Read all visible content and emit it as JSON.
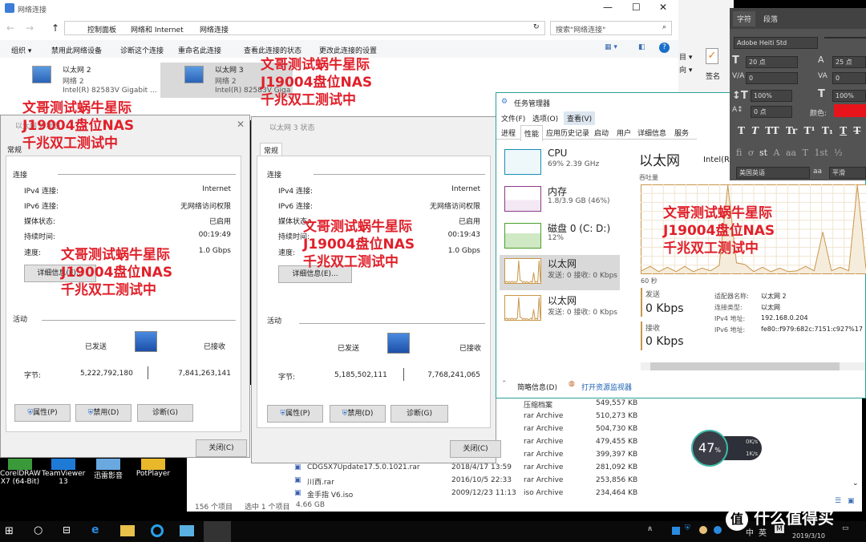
{
  "explorer": {
    "title": "网络连接",
    "breadcrumb": [
      "控制面板",
      "网络和 Internet",
      "网络连接"
    ],
    "search_placeholder": "搜索\"网络连接\"",
    "toolbar": [
      "组织 ▾",
      "禁用此网络设备",
      "诊断这个连接",
      "重命名此连接",
      "查看此连接的状态",
      "更改此连接的设置"
    ],
    "adapters": [
      {
        "name": "以太网 2",
        "network": "网络 2",
        "device": "Intel(R) 82583V Gigabit ..."
      },
      {
        "name": "以太网 3",
        "network": "网络 2",
        "device": "Intel(R) 82583V Gigabit ..."
      }
    ]
  },
  "side_window": {
    "ribbon_label": "签名",
    "ribbon_items": [
      "目 ▾",
      "向 ▾"
    ]
  },
  "dialog1": {
    "title": "以太网 2 状态",
    "tab": "常规",
    "section_connection": "连接",
    "rows": [
      [
        "IPv4 连接:",
        "Internet"
      ],
      [
        "IPv6 连接:",
        "无网络访问权限"
      ],
      [
        "媒体状态:",
        "已启用"
      ],
      [
        "持续时间:",
        "00:19:49"
      ],
      [
        "速度:",
        "1.0 Gbps"
      ]
    ],
    "details_button": "详细信息(E)...",
    "section_activity": "活动",
    "sent_label": "已发送",
    "received_label": "已接收",
    "bytes_label": "字节:",
    "bytes_sent": "5,222,792,180",
    "bytes_received": "7,841,263,141",
    "buttons": [
      "属性(P)",
      "禁用(D)",
      "诊断(G)"
    ],
    "close": "关闭(C)"
  },
  "dialog2": {
    "title": "以太网 3 状态",
    "tab": "常规",
    "section_connection": "连接",
    "rows": [
      [
        "IPv4 连接:",
        "Internet"
      ],
      [
        "IPv6 连接:",
        "无网络访问权限"
      ],
      [
        "媒体状态:",
        "已启用"
      ],
      [
        "持续时间:",
        "00:19:43"
      ],
      [
        "速度:",
        "1.0 Gbps"
      ]
    ],
    "details_button": "详细信息(E)...",
    "section_activity": "活动",
    "sent_label": "已发送",
    "received_label": "已接收",
    "bytes_label": "字节:",
    "bytes_sent": "5,185,502,111",
    "bytes_received": "7,768,241,065",
    "buttons": [
      "属性(P)",
      "禁用(D)",
      "诊断(G)"
    ],
    "close": "关闭(C)"
  },
  "task_manager": {
    "title": "任务管理器",
    "menu": [
      "文件(F)",
      "选项(O)",
      "查看(V)"
    ],
    "tabs": [
      "进程",
      "性能",
      "应用历史记录",
      "启动",
      "用户",
      "详细信息",
      "服务"
    ],
    "active_tab": "性能",
    "items": [
      {
        "name": "CPU",
        "detail": "69% 2.39 GHz"
      },
      {
        "name": "内存",
        "detail": "1.8/3.9 GB (46%)"
      },
      {
        "name": "磁盘 0 (C: D:)",
        "detail": "12%"
      },
      {
        "name": "以太网",
        "detail": "发送: 0 接收: 0 Kbps"
      },
      {
        "name": "以太网",
        "detail": "发送: 0 接收: 0 Kbps"
      }
    ],
    "heading": "以太网",
    "adapter_short": "Intel(R",
    "graph_label": "吞吐量",
    "time_label": "60 秒",
    "throughput_graph": [
      3,
      8,
      2,
      7,
      2,
      8,
      2,
      6,
      3,
      9,
      100,
      12,
      10,
      2,
      7,
      2,
      6,
      2,
      3,
      8,
      3,
      47,
      3,
      7,
      3,
      100,
      5
    ],
    "send_label": "发送",
    "send_value": "0 Kbps",
    "recv_label": "接收",
    "recv_value": "0 Kbps",
    "props": [
      [
        "适配器名称:",
        "以太网 2"
      ],
      [
        "连接类型:",
        "以太网"
      ],
      [
        "IPv4 地址:",
        "192.168.0.204"
      ],
      [
        "IPv6 地址:",
        "fe80::f979:682c:7151:c927%17"
      ]
    ],
    "fewer_details": "简略信息(D)",
    "open_monitor": "打开资源监视器"
  },
  "photoshop": {
    "tabs": [
      "字符",
      "段落"
    ],
    "font": "Adobe Heiti Std",
    "size": "20 点",
    "leading": "25 点",
    "kerning": "0",
    "tracking": "0",
    "vscale": "100%",
    "hscale": "100%",
    "baseline": "0 点",
    "color_label": "颜色:",
    "color": "#e8141c",
    "styles": [
      "T",
      "T",
      "TT",
      "Tr",
      "T¹",
      "T₁",
      "T",
      "T"
    ],
    "ligatures": [
      "fi",
      "ơ",
      "st",
      "A",
      "aa",
      "T",
      "1st",
      "½"
    ],
    "language": "美国英语",
    "aa_label": "aa",
    "antialias": "平滑"
  },
  "file_list": {
    "files": [
      {
        "name": "",
        "date": "",
        "type": "压缩档案",
        "size": "549,557 KB"
      },
      {
        "name": "",
        "date": "",
        "type": "rar Archive",
        "size": "510,273 KB"
      },
      {
        "name": "",
        "date": "",
        "type": "rar Archive",
        "size": "504,730 KB"
      },
      {
        "name": "",
        "date": "",
        "type": "rar Archive",
        "size": "479,455 KB"
      },
      {
        "name": "",
        "date": "",
        "type": "rar Archive",
        "size": "399,397 KB"
      },
      {
        "name": "CDGSX7Update17.5.0.1021.rar",
        "date": "2018/4/17 13:59",
        "type": "rar Archive",
        "size": "281,092 KB"
      },
      {
        "name": "川西.rar",
        "date": "2016/10/5 22:33",
        "type": "rar Archive",
        "size": "253,856 KB"
      },
      {
        "name": "金手指 V6.iso",
        "date": "2009/12/23 11:13",
        "type": "iso Archive",
        "size": "234,464 KB"
      }
    ],
    "status_count": "156 个项目",
    "status_selected": "选中 1 个项目",
    "status_size": "4.66 GB"
  },
  "desktop_icons": [
    {
      "label": "CorelDRAW X7 (64-Bit)"
    },
    {
      "label": "TeamViewer 13"
    },
    {
      "label": "迅雷影音"
    },
    {
      "label": "PotPlayer"
    }
  ],
  "widget": {
    "percent": "47",
    "unit": "%",
    "up": "0K/s",
    "down": "1K/s"
  },
  "taskbar": {
    "ime_mode": "中",
    "ime_lang": "英",
    "date": "2019/3/10"
  },
  "watermark": "什么值得买",
  "overlay_text": [
    "文哥测试蜗牛星际",
    "J19004盘位NAS",
    "千兆双工测试中"
  ],
  "colors": {
    "overlay": "#e0202a",
    "ethernet_graph": "#c8964a",
    "cpu_graph": "#1a8fb6",
    "mem_graph": "#8b3a8b",
    "disk_graph": "#4aa02a"
  }
}
